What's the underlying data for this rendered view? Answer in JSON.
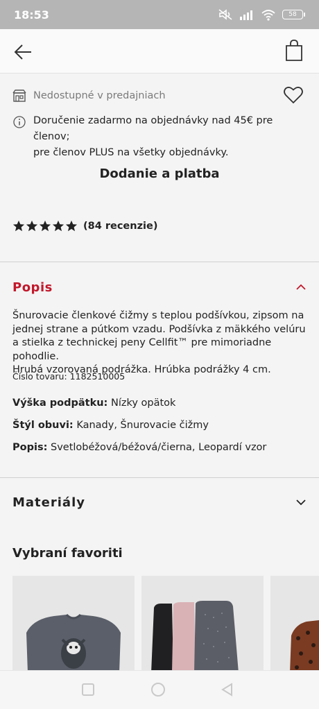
{
  "status_bar": {
    "time": "18:53",
    "battery": "58",
    "icons": [
      "mute-icon",
      "signal-icon",
      "wifi-icon",
      "battery-icon"
    ]
  },
  "header": {
    "back_icon": "arrow-left-icon",
    "bag_icon": "shopping-bag-icon"
  },
  "store": {
    "label": "Nedostupné v predajniach",
    "icon": "store-icon",
    "favorite_icon": "heart-icon"
  },
  "delivery_info": {
    "icon": "info-icon",
    "text_line1": "Doručenie zadarmo na objednávky nad 45€ pre členov;",
    "text_line2": "pre členov PLUS na všetky objednávky."
  },
  "shipping_title": "Dodanie a platba",
  "rating": {
    "stars": 5,
    "count_label": "(84 recenzie)"
  },
  "description_section": {
    "title": "Popis",
    "text_lines": [
      "Šnurovacie členkové čižmy s teplou podšívkou, zipsom na",
      "jednej strane a pútkom vzadu. Podšívka z mäkkého velúru",
      "a stielka z technickej peny Cellfit™ pre mimoriadne pohodlie.",
      "Hrubá vzorovaná podrážka. Hrúbka podrážky 4 cm."
    ],
    "article_number": "Číslo tovaru: 1182510005",
    "attributes": [
      {
        "label": "Výška podpätku:",
        "value": "Nízky opätok"
      },
      {
        "label": "Štýl obuvi:",
        "value": "Kanady, Šnurovacie čižmy"
      },
      {
        "label": "Popis:",
        "value": "Svetlobéžová/béžová/čierna, Leopardí vzor"
      }
    ]
  },
  "materials_section": {
    "title": "Materiály"
  },
  "favorites": {
    "title": "Vybraní favoriti"
  },
  "colors": {
    "accent_red": "#c2182b",
    "text": "#222222",
    "muted": "#7a7a7a"
  }
}
